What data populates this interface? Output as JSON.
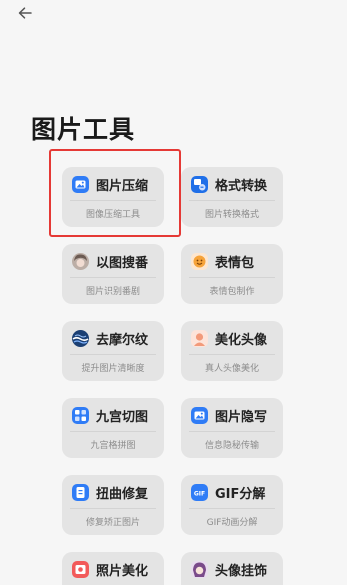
{
  "header": {
    "title": "图片工具",
    "back_icon": "arrow-left-icon"
  },
  "highlight_color": "#e53935",
  "tools": [
    {
      "id": "compress",
      "name": "图片压缩",
      "desc": "图像压缩工具",
      "icon": "image-icon",
      "color": "#2f7cf6"
    },
    {
      "id": "format",
      "name": "格式转换",
      "desc": "图片转换格式",
      "icon": "format-convert-icon",
      "color": "#1f6fe8"
    },
    {
      "id": "search",
      "name": "以图搜番",
      "desc": "图片识别番剧",
      "icon": "anime-avatar-icon",
      "color": "#6b5a52"
    },
    {
      "id": "emoji",
      "name": "表情包",
      "desc": "表情包制作",
      "icon": "emoji-icon",
      "color": "#f6a33a"
    },
    {
      "id": "moire",
      "name": "去摩尔纹",
      "desc": "提升图片清晰度",
      "icon": "wave-icon",
      "color": "#1b3f73"
    },
    {
      "id": "avatar",
      "name": "美化头像",
      "desc": "真人头像美化",
      "icon": "person-avatar-icon",
      "color": "#f29a7a"
    },
    {
      "id": "grid",
      "name": "九宫切图",
      "desc": "九宫格拼图",
      "icon": "grid-icon",
      "color": "#2f7cf6"
    },
    {
      "id": "hide",
      "name": "图片隐写",
      "desc": "信息隐秘传输",
      "icon": "image-icon",
      "color": "#2f7cf6"
    },
    {
      "id": "fix",
      "name": "扭曲修复",
      "desc": "修复矫正图片",
      "icon": "document-icon",
      "color": "#2f7cf6"
    },
    {
      "id": "gif",
      "name": "GIF分解",
      "desc": "GIF动画分解",
      "icon": "gif-icon",
      "color": "#2f7cf6"
    },
    {
      "id": "beautify",
      "name": "照片美化",
      "desc": "",
      "icon": "photo-beautify-icon",
      "color": "#f25a5a"
    },
    {
      "id": "pendant",
      "name": "头像挂饰",
      "desc": "",
      "icon": "anime-character-icon",
      "color": "#7a4a8a"
    }
  ]
}
